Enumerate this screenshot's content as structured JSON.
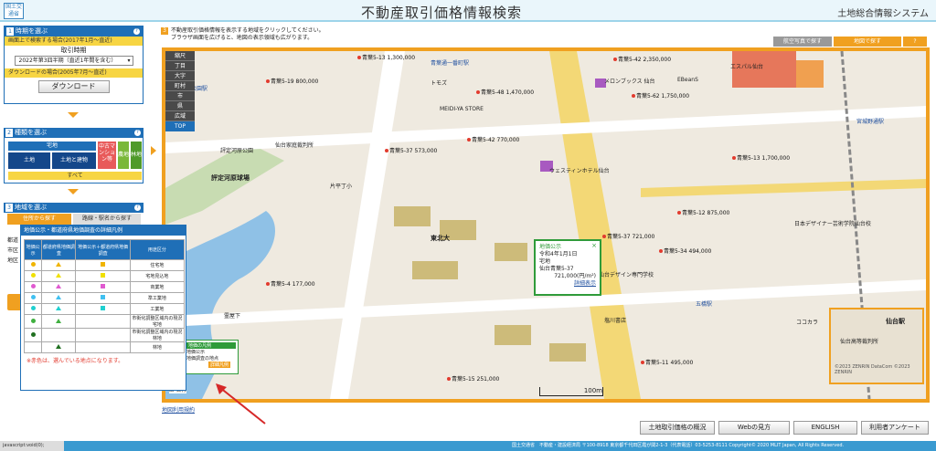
{
  "header": {
    "logo_text": "国土交通省",
    "title": "不動産取引価格情報検索",
    "subtitle": "土地総合情報システム"
  },
  "sidebar": {
    "section1": {
      "num": "1",
      "title": "時期を選ぶ",
      "help": "?",
      "bar1": "画面上で検索する場合(2017年1月～直近)",
      "period_label": "取引時期",
      "period_value": "2022年第3四半期（直近1年間を含む）",
      "bar2": "ダウンロードの場合(2005年7月～直近)",
      "download_button": "ダウンロード"
    },
    "section2": {
      "num": "2",
      "title": "種類を選ぶ",
      "help": "?",
      "takuchi": "宅地",
      "tochi": "土地",
      "tochi_tatemono": "土地と建物",
      "chuko": "中古マンション等",
      "nochi": "農地",
      "rinchi": "林地",
      "all": "すべて"
    },
    "section3": {
      "num": "3",
      "title": "地域を選ぶ",
      "help": "?",
      "tab1": "住所から探す",
      "tab2": "路線・駅名から探す",
      "stub1": "都道",
      "stub2": "市区",
      "stub3": "地区"
    }
  },
  "main": {
    "instruction_num": "3",
    "instruction1": "不動産取引価格情報を表示する地域をクリックしてください。",
    "instruction2": "ブラウザ画面を広げると、地図の表示領域も広がります。",
    "tab_aerial": "航空写真で探す",
    "tab_map": "地図で探す",
    "tab_help": "?",
    "layers": [
      "縮尺",
      "丁目",
      "大字",
      "町村",
      "市",
      "県",
      "広域"
    ],
    "layer_top": "TOP",
    "map_note": "地図利用規約",
    "scale_label": "100m"
  },
  "map": {
    "labels": [
      {
        "t": "仙台駅",
        "cls": "big"
      },
      {
        "t": "東北大",
        "cls": "big"
      },
      {
        "t": "北四番丁駅",
        "cls": "blue"
      },
      {
        "t": "勾当台公園駅",
        "cls": "blue"
      },
      {
        "t": "広瀬通駅",
        "cls": "blue"
      },
      {
        "t": "青葉通一番町駅",
        "cls": "blue"
      },
      {
        "t": "大町西公園駅",
        "cls": "blue"
      },
      {
        "t": "国際センター駅",
        "cls": "blue"
      },
      {
        "t": "評定河原公園",
        "cls": ""
      },
      {
        "t": "評定河原球場",
        "cls": ""
      },
      {
        "t": "仙台家庭裁判所",
        "cls": ""
      },
      {
        "t": "東北大学病院",
        "cls": ""
      },
      {
        "t": "片平丁小",
        "cls": ""
      },
      {
        "t": "五橋駅",
        "cls": "blue"
      },
      {
        "t": "東北学院大",
        "cls": ""
      },
      {
        "t": "仙台デザイン専門学校",
        "cls": ""
      },
      {
        "t": "塩川書店",
        "cls": ""
      },
      {
        "t": "ウェスティンホテル仙台",
        "cls": ""
      },
      {
        "t": "トモズ",
        "cls": ""
      },
      {
        "t": "MEIDI-YA STORE",
        "cls": ""
      },
      {
        "t": "メロンブックス 仙台",
        "cls": ""
      },
      {
        "t": "EBeanS",
        "cls": ""
      },
      {
        "t": "仙台中央郵便局",
        "cls": ""
      },
      {
        "t": "霊屋下",
        "cls": ""
      },
      {
        "t": "日本デザイナー芸術学院仙台校",
        "cls": ""
      },
      {
        "t": "ココカラ",
        "cls": ""
      },
      {
        "t": "仙台高等裁判所",
        "cls": ""
      },
      {
        "t": "宮城野通駅",
        "cls": "blue"
      },
      {
        "t": "エスパル仙台",
        "cls": ""
      },
      {
        "t": "仙台駅",
        "cls": "blue"
      }
    ],
    "prices": [
      "青葉5-13 1,300,000",
      "青葉5-19 800,000",
      "青葉5-48 1,470,000",
      "青葉5-62 1,750,000",
      "青葉5-42 2,350,000",
      "青葉5-42 770,000",
      "青葉5-37 573,000",
      "青葉5-37 721,000",
      "青葉5-34 494,000",
      "青葉5-4 177,000",
      "青葉5-15 251,000",
      "青葉5-11 495,000",
      "青葉5-12 875,000",
      "青葉5-13 1,700,000"
    ]
  },
  "popup": {
    "title": "地価公示",
    "date": "令和4年1月1日",
    "use": "宅地",
    "address": "仙台青葉5-37",
    "price": "721,000(円/m²)",
    "link": "詳細表示",
    "close": "×"
  },
  "legend": {
    "title": "地価公示・都道府県地価調査の詳細凡例",
    "col1": "地価公示",
    "col2": "都道府県地価調査",
    "col3": "地価公示＋都道府県地価調査",
    "col4": "用途区分",
    "rows": [
      {
        "use": "住宅地",
        "c1": "#f0b400",
        "c2": "#f0b400",
        "c3": "#f0b400"
      },
      {
        "use": "宅地見込地",
        "c1": "#f0e000",
        "c2": "#f0e000",
        "c3": "#f0e000"
      },
      {
        "use": "商業地",
        "c1": "#e05ad0",
        "c2": "#e05ad0",
        "c3": "#e05ad0"
      },
      {
        "use": "準工業地",
        "c1": "#40c0f0",
        "c2": "#40c0f0",
        "c3": "#40c0f0"
      },
      {
        "use": "工業地",
        "c1": "#20d0d0",
        "c2": "#20d0d0",
        "c3": "#20d0d0"
      },
      {
        "use": "市街化調整区域内の現況宅地",
        "c1": "#40b040",
        "c2": "#40b040",
        "c3": ""
      },
      {
        "use": "市街化調整区域内の現況林地",
        "c1": "#207020",
        "c2": "",
        "c3": ""
      },
      {
        "use": "林地",
        "c1": "",
        "c2": "#207020",
        "c3": ""
      }
    ],
    "note": "※赤色は、選んでいる地点になります。"
  },
  "map_legend": {
    "title": "地価の凡例",
    "item1": "地価公示",
    "item2": "地価調査の地点",
    "btn": "詳細凡例",
    "names": "名称"
  },
  "footer": {
    "links": [
      "土地取引価格の概況",
      "Webの見方",
      "ENGLISH",
      "利用者アンケート"
    ]
  },
  "status": {
    "left": "javascript:void(0);",
    "right": "国土交通省　不動産・建設経済局 〒100-8918 東京都千代田区霞が関2-1-3（代表電話）03-5253-8111 Copyright© 2020 MLIT Japan, All Rights Reserved."
  },
  "copyright": "©2023 ZENRIN DataCom ©2023 ZENRIN"
}
